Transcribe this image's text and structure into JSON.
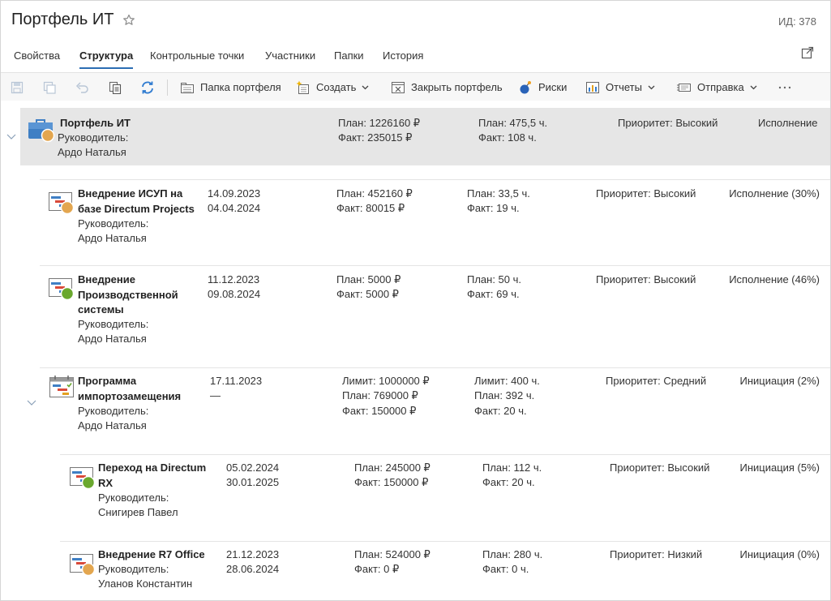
{
  "header": {
    "title": "Портфель ИТ",
    "id_label": "ИД: 378"
  },
  "tabs": [
    {
      "label": "Свойства"
    },
    {
      "label": "Структура",
      "active": true
    },
    {
      "label": "Контрольные точки"
    },
    {
      "label": "Участники"
    },
    {
      "label": "Папки"
    },
    {
      "label": "История"
    }
  ],
  "toolbar": {
    "portfolio_folder": "Папка портфеля",
    "create": "Создать",
    "close_portfolio": "Закрыть портфель",
    "risks": "Риски",
    "reports": "Отчеты",
    "send": "Отправка"
  },
  "portfolio": {
    "name": "Портфель ИТ",
    "manager_label": "Руководитель:",
    "manager": "Ардо Наталья",
    "plan_cost": "План: 1226160 ₽",
    "fact_cost": "Факт: 235015 ₽",
    "plan_hours": "План: 475,5 ч.",
    "fact_hours": "Факт: 108 ч.",
    "priority": "Приоритет: Высокий",
    "status": "Исполнение"
  },
  "items": [
    {
      "name_lines": [
        "Внедрение ИСУП на",
        "базе Directum Projects"
      ],
      "manager_label": "Руководитель:",
      "manager": "Ардо Наталья",
      "start": "14.09.2023",
      "end": "04.04.2024",
      "plan_cost": "План: 452160 ₽",
      "fact_cost": "Факт: 80015 ₽",
      "plan_hours": "План: 33,5 ч.",
      "fact_hours": "Факт: 19 ч.",
      "priority": "Приоритет: Высокий",
      "status": "Исполнение (30%)",
      "status_color": "#e3a64f"
    },
    {
      "name_lines": [
        "Внедрение",
        "Производственной",
        "системы"
      ],
      "manager_label": "Руководитель:",
      "manager": "Ардо Наталья",
      "start": "11.12.2023",
      "end": "09.08.2024",
      "plan_cost": "План: 5000 ₽",
      "fact_cost": "Факт: 5000 ₽",
      "plan_hours": "План: 50 ч.",
      "fact_hours": "Факт: 69 ч.",
      "priority": "Приоритет: Высокий",
      "status": "Исполнение (46%)",
      "status_color": "#6aa82e"
    },
    {
      "name_lines": [
        "Программа",
        "импортозамещения"
      ],
      "manager_label": "Руководитель:",
      "manager": "Ардо Наталья",
      "start": "17.11.2023",
      "end": "—",
      "limit_cost": "Лимит: 1000000 ₽",
      "plan_cost": "План: 769000 ₽",
      "fact_cost": "Факт: 150000 ₽",
      "limit_hours": "Лимит: 400 ч.",
      "plan_hours": "План: 392 ч.",
      "fact_hours": "Факт: 20 ч.",
      "priority": "Приоритет: Средний",
      "status": "Инициация (2%)"
    },
    {
      "name_lines": [
        "Переход на Directum",
        "RX"
      ],
      "manager_label": "Руководитель:",
      "manager": "Снигирев Павел",
      "start": "05.02.2024",
      "end": "30.01.2025",
      "plan_cost": "План: 245000 ₽",
      "fact_cost": "Факт: 150000 ₽",
      "plan_hours": "План: 112 ч.",
      "fact_hours": "Факт: 20 ч.",
      "priority": "Приоритет: Высокий",
      "status": "Инициация (5%)",
      "status_color": "#6aa82e"
    },
    {
      "name_lines": [
        "Внедрение R7 Office"
      ],
      "manager_label": "Руководитель:",
      "manager": "Уланов Константин",
      "start": "21.12.2023",
      "end": "28.06.2024",
      "plan_cost": "План: 524000 ₽",
      "fact_cost": "Факт: 0 ₽",
      "plan_hours": "План: 280 ч.",
      "fact_hours": "Факт: 0 ч.",
      "priority": "Приоритет: Низкий",
      "status": "Инициация (0%)",
      "status_color": "#e3a64f"
    }
  ]
}
